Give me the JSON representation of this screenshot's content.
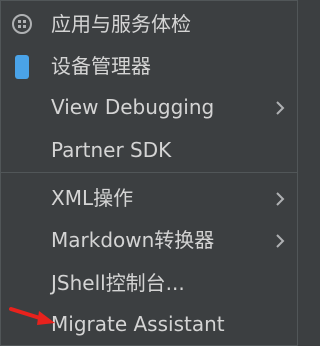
{
  "menu": {
    "items": [
      {
        "label": "应用与服务体检",
        "icon": "app-health-icon"
      },
      {
        "label": "设备管理器",
        "icon": "phone-icon"
      },
      {
        "label": "View Debugging",
        "submenu": true
      },
      {
        "label": "Partner SDK"
      },
      {
        "label": "XML操作",
        "submenu": true
      },
      {
        "label": "Markdown转换器",
        "submenu": true
      },
      {
        "label": "JShell控制台..."
      },
      {
        "label": "Migrate Assistant"
      }
    ]
  },
  "colors": {
    "background": "#3c3f41",
    "text": "#d4d4d4",
    "separator": "#515658",
    "phone_icon": "#4aa3e8",
    "annotation_arrow": "#e8221d"
  }
}
